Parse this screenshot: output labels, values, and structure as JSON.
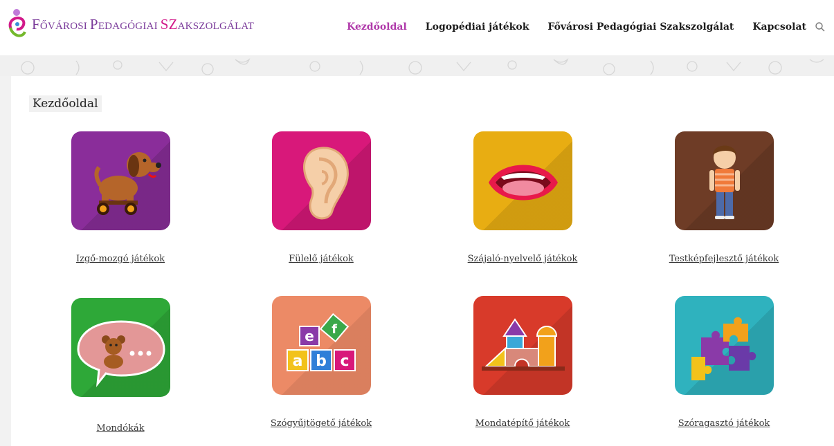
{
  "header": {
    "logo_text": {
      "part1_cap": "F",
      "part1_small": "ŐVÁROSI ",
      "part2_cap": "P",
      "part2_small": "EDAGÓGIAI ",
      "part3_cap": "SZ",
      "part3_small": "AKSZOLGÁLAT"
    },
    "nav": [
      {
        "label": "Kezdőoldal",
        "active": true
      },
      {
        "label": "Logopédiai játékok",
        "active": false
      },
      {
        "label": "Fővárosi Pedagógiai Szakszolgálat",
        "active": false
      },
      {
        "label": "Kapcsolat",
        "active": false
      }
    ],
    "search_icon": "search-icon"
  },
  "main": {
    "page_title": "Kezdőoldal",
    "cards": [
      {
        "label": "Izgő-mozgó játékok",
        "icon": "dog-toy-icon",
        "color": "#8a2d9a"
      },
      {
        "label": "Fülelő játékok",
        "icon": "ear-icon",
        "color": "#d8187a"
      },
      {
        "label": "Szájaló-nyelvelő játékok",
        "icon": "mouth-icon",
        "color": "#e8ad12"
      },
      {
        "label": "Testképfejlesztő játékok",
        "icon": "boy-icon",
        "color": "#6e3c26"
      },
      {
        "label": "Mondókák",
        "icon": "speech-bubble-bear-icon",
        "color": "#2ea838"
      },
      {
        "label": "Szógyűjtögető játékok",
        "icon": "letter-blocks-icon",
        "color": "#ec8a66"
      },
      {
        "label": "Mondatépítő játékok",
        "icon": "building-blocks-icon",
        "color": "#d83a2a"
      },
      {
        "label": "Szóragasztó játékok",
        "icon": "puzzle-icon",
        "color": "#2fb2be"
      }
    ],
    "letter_blocks": [
      "e",
      "f",
      "a",
      "b",
      "c"
    ]
  },
  "colors": {
    "nav_active": "#b03aaa",
    "logo_purple": "#7a3a9a",
    "logo_pink": "#d21a8a"
  }
}
